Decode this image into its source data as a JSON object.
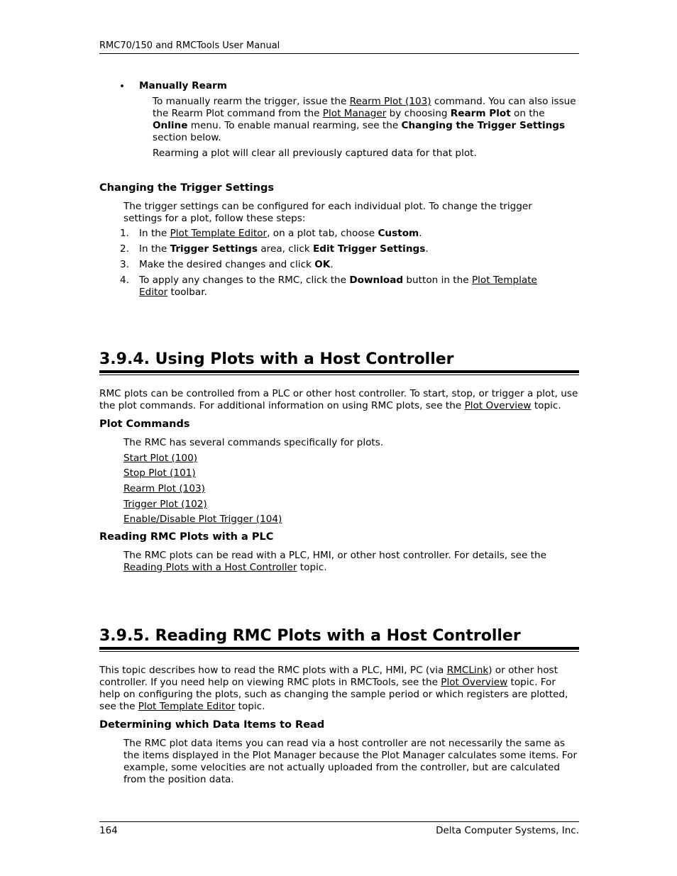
{
  "header": {
    "title": "RMC70/150 and RMCTools User Manual"
  },
  "footer": {
    "page_number": "164",
    "company": "Delta Computer Systems, Inc."
  },
  "manually_rearm": {
    "bullet": "•",
    "title": "Manually Rearm",
    "p1_a": "To manually rearm the trigger, issue the ",
    "p1_link1": "Rearm Plot (103)",
    "p1_b": " command. You can also issue the Rearm Plot command from the ",
    "p1_link2": "Plot Manager",
    "p1_c": " by choosing ",
    "p1_bold1": "Rearm Plot",
    "p1_d": " on the ",
    "p1_bold2": "Online",
    "p1_e": " menu. To enable manual rearming, see the ",
    "p1_bold3": "Changing the Trigger Settings",
    "p1_f": " section below.",
    "p2": "Rearming a plot will clear all previously captured data for that plot."
  },
  "trigger_settings": {
    "title": "Changing the Trigger Settings",
    "intro": "The trigger settings can be configured for each individual plot. To change the trigger settings for a plot, follow these steps:",
    "steps": [
      {
        "num": "1.",
        "a": "In the ",
        "link": "Plot Template Editor",
        "b": ", on a plot tab, choose ",
        "bold": "Custom",
        "c": "."
      },
      {
        "num": "2.",
        "a": "In the ",
        "bold1": "Trigger Settings",
        "b": " area, click ",
        "bold2": "Edit Trigger Settings",
        "c": "."
      },
      {
        "num": "3.",
        "a": "Make the desired changes and click ",
        "bold": "OK",
        "c": "."
      },
      {
        "num": "4.",
        "a": "To apply any changes to the RMC, click the ",
        "bold": "Download",
        "b": " button in the ",
        "link": "Plot Template Editor",
        "c": " toolbar."
      }
    ]
  },
  "section_394": {
    "title": "3.9.4. Using Plots with a Host Controller",
    "intro_a": "RMC plots can be controlled from a PLC or other host controller. To start, stop, or trigger a plot, use the plot commands. For additional information on using RMC plots, see the ",
    "intro_link": "Plot Overview",
    "intro_b": " topic.",
    "plot_commands_title": "Plot Commands",
    "plot_commands_intro": "The RMC has several commands specifically for plots.",
    "commands": [
      "Start Plot (100)",
      "Stop Plot (101)",
      "Rearm Plot (103)",
      "Trigger Plot (102)",
      "Enable/Disable Plot Trigger (104)"
    ],
    "reading_title": "Reading RMC Plots with a PLC",
    "reading_a": "The RMC plots can be read with a PLC, HMI, or other host controller. For details, see the ",
    "reading_link": "Reading Plots with a Host Controller",
    "reading_b": " topic."
  },
  "section_395": {
    "title": "3.9.5. Reading RMC Plots with a Host Controller",
    "intro_a": "This topic describes how to read the RMC plots with a PLC, HMI, PC (via ",
    "intro_link1": "RMCLink",
    "intro_b": ") or other host controller. If you need help on viewing RMC plots in RMCTools, see the ",
    "intro_link2": "Plot Overview",
    "intro_c": " topic. For help on configuring the plots, such as changing the sample period or which registers are plotted, see the ",
    "intro_link3": "Plot Template Editor",
    "intro_d": " topic.",
    "determining_title": "Determining which Data Items to Read",
    "determining_text": "The RMC plot data items you can read via a host controller are not necessarily the same as the items displayed in the Plot Manager because the Plot Manager calculates some items. For example, some velocities are not actually uploaded from the controller, but are calculated from the position data."
  }
}
